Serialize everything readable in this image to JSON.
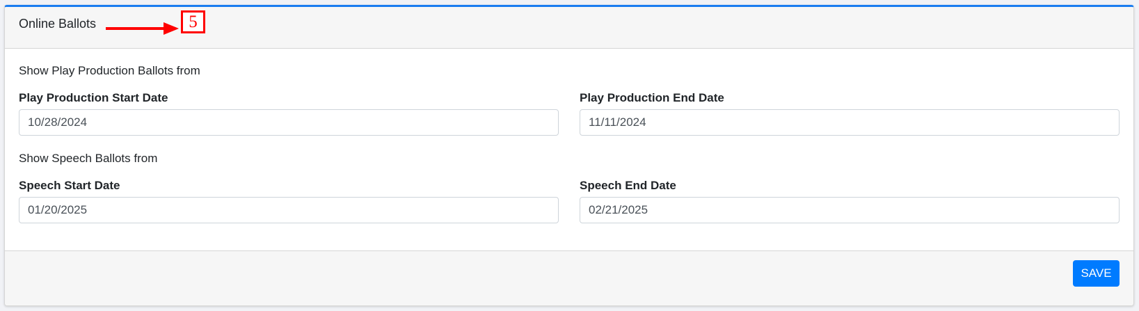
{
  "header": {
    "title": "Online Ballots",
    "annotation_number": "5"
  },
  "play": {
    "section_text": "Show Play Production Ballots from",
    "start_label": "Play Production Start Date",
    "start_value": "10/28/2024",
    "end_label": "Play Production End Date",
    "end_value": "11/11/2024"
  },
  "speech": {
    "section_text": "Show Speech Ballots from",
    "start_label": "Speech Start Date",
    "start_value": "01/20/2025",
    "end_label": "Speech End Date",
    "end_value": "02/21/2025"
  },
  "footer": {
    "save_label": "SAVE"
  },
  "colors": {
    "accent": "#007bff",
    "annotation": "#ff0000"
  }
}
